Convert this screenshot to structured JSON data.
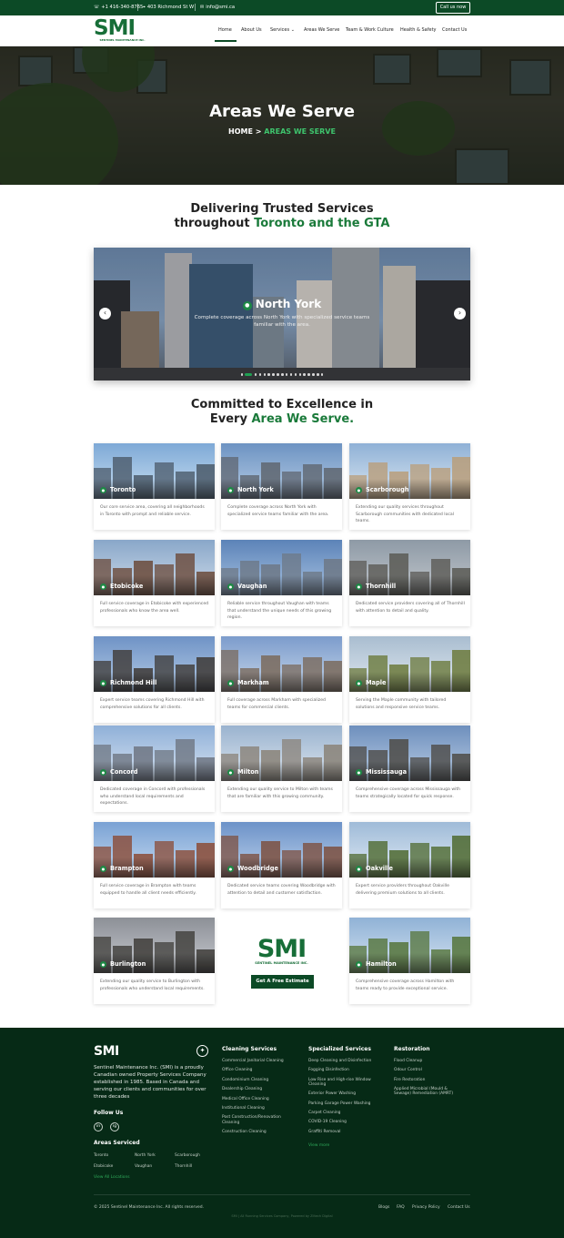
{
  "topbar": {
    "phone": "+1 416-340-8765",
    "address": "403 Richmond St W",
    "email": "info@smi.ca",
    "call_button": "Call us now"
  },
  "brand": {
    "logo_text": "SMI",
    "logo_sub": "SENTINEL MAINTENANCE INC."
  },
  "nav": {
    "items": [
      "Home",
      "About Us",
      "Services",
      "Areas We Serve",
      "Team & Work Culture",
      "Health & Safety",
      "Contact Us"
    ],
    "active": "Home"
  },
  "hero": {
    "title": "Areas We Serve",
    "breadcrumb_home": "HOME",
    "breadcrumb_sep": ">",
    "breadcrumb_current": "AREAS WE SERVE"
  },
  "intro": {
    "line1": "Delivering Trusted Services",
    "line2_prefix": "throughout",
    "line2_highlight": "Toronto and the GTA"
  },
  "slider": {
    "title": "North York",
    "description": "Complete coverage across North York with specialized service teams familiar with the area.",
    "prev_icon": "chevron-left-icon",
    "next_icon": "chevron-right-icon",
    "slide_count": 18,
    "active_index": 1
  },
  "committed": {
    "line1": "Committed to Excellence in",
    "line2_prefix": "Every",
    "line2_highlight": "Area We Serve."
  },
  "areas": [
    {
      "name": "Toronto",
      "text": "Our core service area, covering all neighborhoods in Toronto with prompt and reliable service."
    },
    {
      "name": "North York",
      "text": "Complete coverage across North York with specialized service teams familiar with the area."
    },
    {
      "name": "Scarborough",
      "text": "Extending our quality services throughout Scarborough communities with dedicated local teams."
    },
    {
      "name": "Etobicoke",
      "text": "Full service coverage in Etobicoke with experienced professionals who know the area well."
    },
    {
      "name": "Vaughan",
      "text": "Reliable service throughout Vaughan with teams that understand the unique needs of this growing region."
    },
    {
      "name": "Thornhill",
      "text": "Dedicated service providers covering all of Thornhill with attention to detail and quality."
    },
    {
      "name": "Richmond Hill",
      "text": "Expert service teams covering Richmond Hill with comprehensive solutions for all clients."
    },
    {
      "name": "Markham",
      "text": "Full coverage across Markham with specialized teams for commercial clients."
    },
    {
      "name": "Maple",
      "text": "Serving the Maple community with tailored solutions and responsive service teams."
    },
    {
      "name": "Concord",
      "text": "Dedicated coverage in Concord with professionals who understand local requirements and expectations."
    },
    {
      "name": "Milton",
      "text": "Extending our quality service to Milton with teams that are familiar with this growing community."
    },
    {
      "name": "Mississauga",
      "text": "Comprehensive coverage across Mississauga with teams strategically located for quick response."
    },
    {
      "name": "Brampton",
      "text": "Full service coverage in Brampton with teams equipped to handle all client needs efficiently."
    },
    {
      "name": "Woodbridge",
      "text": "Dedicated service teams covering Woodbridge with attention to detail and customer satisfaction."
    },
    {
      "name": "Oakville",
      "text": "Expert service providers throughout Oakville delivering premium solutions to all clients."
    },
    {
      "name": "Burlington",
      "text": "Extending our quality service to Burlington with professionals who understand local requirements."
    },
    {
      "name": "Hamilton",
      "text": "Comprehensive coverage across Hamilton with teams ready to provide exceptional service."
    }
  ],
  "promo": {
    "logo_text": "SMI",
    "logo_sub": "SENTINEL MAINTENANCE INC.",
    "button": "Get A Free Estimate"
  },
  "footer": {
    "logo": "SMI",
    "about": "Sentinel Maintenance Inc. (SMI) is a proudly Canadian owned Property Services Company established in 1985. Based in Canada and serving our clients and communities for over three decades",
    "follow_heading": "Follow Us",
    "social": [
      "in",
      "ig"
    ],
    "areas_heading": "Areas Serviced",
    "areas": [
      "Toronto",
      "North York",
      "Scarborough",
      "Etobicoke",
      "Vaughan",
      "Thornhill"
    ],
    "areas_more": "View All Locations",
    "col1": {
      "heading": "Cleaning Services",
      "links": [
        "Commercial Janitorial Cleaning",
        "Office Cleaning",
        "Condominium Cleaning",
        "Dealership Cleaning",
        "Medical Office Cleaning",
        "Institutional Cleaning",
        "Post Construction/Renovation Cleaning",
        "Construction Cleaning"
      ]
    },
    "col2": {
      "heading": "Specialized Services",
      "links": [
        "Deep Cleaning and Disinfection",
        "Fogging Disinfection",
        "Low Rise and High-rise Window Cleaning",
        "Exterior Power Washing",
        "Parking Garage Power Washing",
        "Carpet Cleaning",
        "COVID-19 Cleaning",
        "Graffiti Removal"
      ],
      "more": "View more"
    },
    "col3": {
      "heading": "Restoration",
      "links": [
        "Flood Cleanup",
        "Odour Control",
        "Fire Restoration",
        "Applied Microbial (Mould & Sewage) Remediation (AMRT)"
      ]
    },
    "copyright": "© 2025 Sentinel Maintenance Inc. All rights reserved.",
    "bottom_links": [
      "Blogs",
      "FAQ",
      "Privacy Policy",
      "Contact Us"
    ],
    "credit": "SMI | All Running Services Company, Powered by Ziltech Digital"
  },
  "colors": {
    "brand_green": "#0c4a26",
    "accent_green": "#1a7a3a",
    "footer_bg": "#062a16"
  }
}
